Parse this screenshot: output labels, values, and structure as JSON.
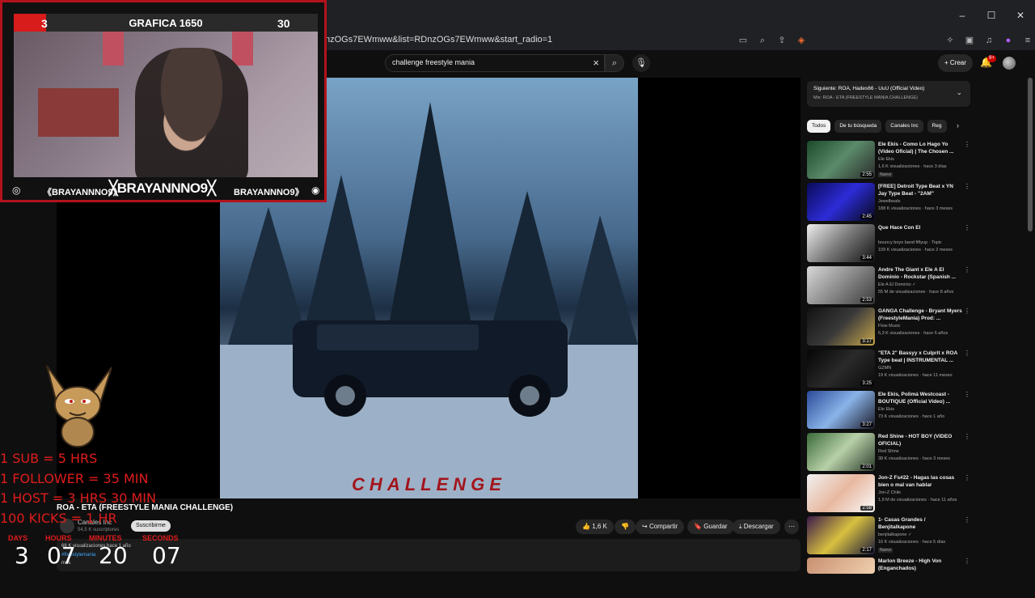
{
  "browser": {
    "url": "nzOGs7EWmww&list=RDnzOGs7EWmww&start_radio=1",
    "window_controls": [
      "–",
      "☐",
      "✕"
    ]
  },
  "header": {
    "search_value": "challenge freestyle mania",
    "create_label": "Crear",
    "notification_count": "9+"
  },
  "video": {
    "art_text": "CHALLENGE",
    "title": "ROA - ETA (FREESTYLE MANIA CHALLENGE)",
    "channel": "Canales Inc",
    "subscribers": "54,5 K suscriptores",
    "subscribe_label": "Suscribirme",
    "likes": "1,6 K",
    "share_label": "Compartir",
    "save_label": "Guardar",
    "download_label": "Descargar",
    "description_views": "66 K visualizaciones hace 1 año",
    "description_tag": "#freestylemania",
    "description_more": "más"
  },
  "upnext": {
    "title": "Siguiente: ROA, Hades66 - UuU (Official Video)",
    "subtitle": "Mix: ROA - ETA (FREESTYLE MANIA CHALLENGE)"
  },
  "chips": [
    "Todos",
    "De tu búsqueda",
    "Canales Inc",
    "Reg"
  ],
  "recommendations": [
    {
      "title": "Ele Ekis - Como Lo Hago Yo (Video Oficial) | The Chosen ...",
      "channel": "Ele Ekis",
      "meta": "1,6 K visualizaciones · hace 3 días",
      "duration": "2:55",
      "badge": "Nuevo"
    },
    {
      "title": "[FREE] Detroit Type Beat x YN Jay Type Beat - \"2AM\"",
      "channel": "Jewelbeats",
      "meta": "188 K visualizaciones · hace 3 meses",
      "duration": "2:45",
      "badge": ""
    },
    {
      "title": "Que Hace Con El",
      "channel": "bouncy boyo band fiftyup · Topic",
      "meta": "109 K visualizaciones · hace 2 meses",
      "duration": "3:44",
      "badge": ""
    },
    {
      "title": "Andre The Giant x Ele A El Dominio - Rockstar (Spanish ...",
      "channel": "Ele A El Dominio ✓",
      "meta": "55 M de visualizaciones · hace 8 años",
      "duration": "2:53",
      "badge": ""
    },
    {
      "title": "GANGA Challenge - Bryant Myers (FreestyleMania) Prod: ...",
      "channel": "Flow Music",
      "meta": "6,3 K visualizaciones · hace 6 años",
      "duration": "3:17",
      "badge": ""
    },
    {
      "title": "\"ETA 2\" Bassyy x Culprit x ROA Type beat | INSTRUMENTAL ...",
      "channel": "GZMN",
      "meta": "19 K visualizaciones · hace 11 meses",
      "duration": "3:25",
      "badge": ""
    },
    {
      "title": "Ele Ekis, Polimá Westcoast - BOUTIQUE (Official Video) ...",
      "channel": "Ele Ekis",
      "meta": "73 K visualizaciones · hace 1 año",
      "duration": "3:27",
      "badge": ""
    },
    {
      "title": "Red Shine - HOT BOY (VIDEO OFICIAL)",
      "channel": "Red Shine",
      "meta": "38 K visualizaciones · hace 3 meses",
      "duration": "2:01",
      "badge": ""
    },
    {
      "title": "Jon-Z Fs#22 - Hagas las cosas bien o mal van hablar",
      "channel": "Jon-Z Chile",
      "meta": "1,9 M de visualizaciones · hace 11 años",
      "duration": "2:58",
      "badge": ""
    },
    {
      "title": "1- Casas Grandes / Benjitalkapone",
      "channel": "benjitalkapone ✓",
      "meta": "16 K visualizaciones · hace 5 días",
      "duration": "2:17",
      "badge": "Nuevo"
    },
    {
      "title": "Marlon Breeze - High Von (Enganchados)",
      "channel": "",
      "meta": "",
      "duration": "",
      "badge": ""
    }
  ],
  "overlay": {
    "left_number": "3",
    "title": "GRAFICA 1650",
    "right_number": "30",
    "tag_small": "《BRAYANNNO9》",
    "tag_main": "╳BRAYANNNO9╳",
    "tag_small_right": "BRAYANNNO9》"
  },
  "subathon": {
    "rules": [
      "1 SUB = 5 HRS",
      "1 FOLLOWER = 35 MIN",
      "1 HOST = 3 HRS 30 MIN",
      "100 KICKS = 1 HR"
    ],
    "labels": [
      "DAYS",
      "HOURS",
      "MINUTES",
      "SECONDS"
    ],
    "values": [
      "3",
      "07",
      "20",
      "07"
    ]
  },
  "colors": {
    "accent_red": "#e01c1c",
    "overlay_border": "#b3121c",
    "bg": "#0f0f0f"
  }
}
